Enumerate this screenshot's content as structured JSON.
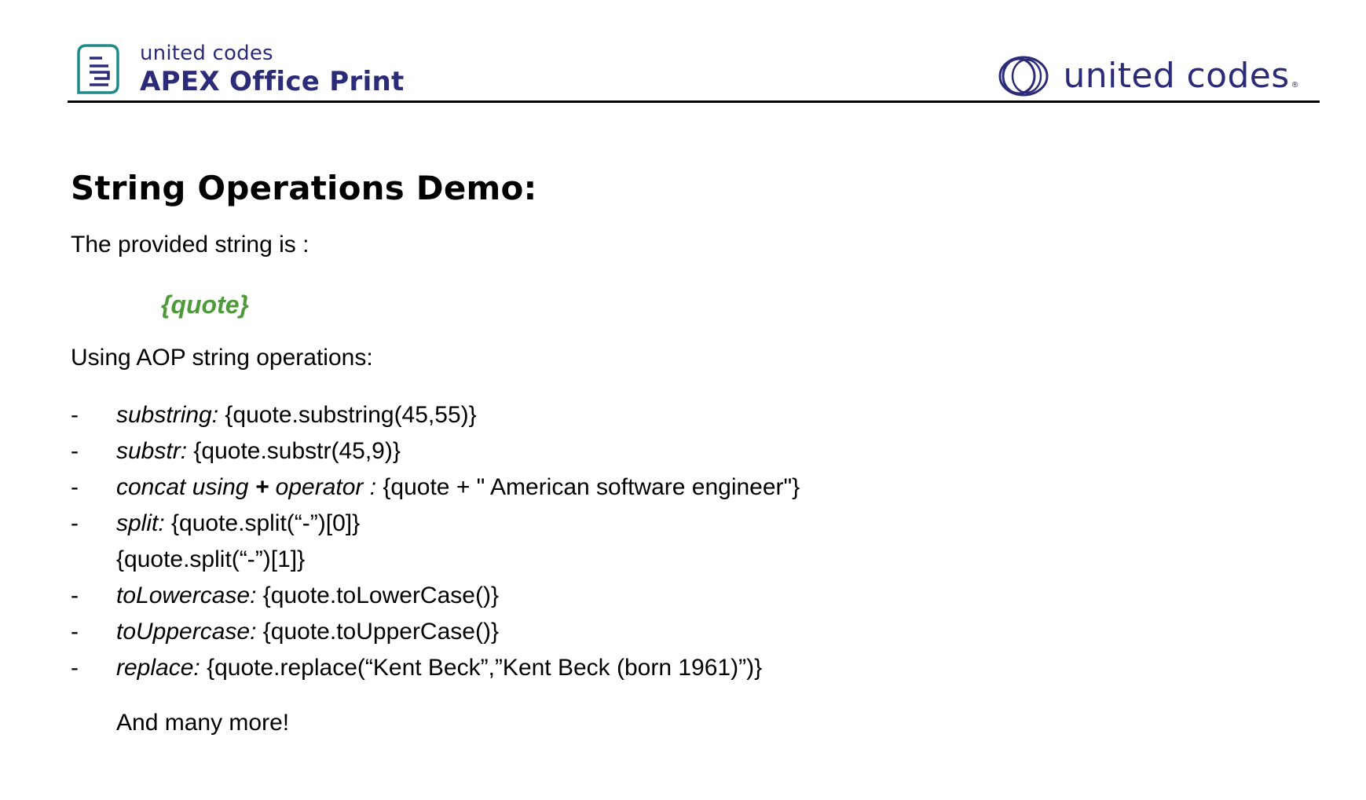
{
  "header": {
    "left_brand_sub": "united codes",
    "left_brand_main": "APEX Office Print",
    "right_brand": "united codes",
    "right_brand_mark": "®",
    "brand_color": "#2c2b78",
    "left_icon": "document-icon",
    "right_icon": "rings-logo-icon"
  },
  "document": {
    "title": "String Operations Demo:",
    "intro": "The provided string is :",
    "quote_placeholder": "{quote}",
    "quote_color": "#4e9a3a",
    "using": "Using AOP string operations:",
    "bullet": "-",
    "operations": [
      {
        "name": "substring:",
        "expr": " {quote.substring(45,55)}"
      },
      {
        "name": "substr:",
        "expr": " {quote.substr(45,9)}"
      },
      {
        "name_a": "concat using ",
        "name_plus": "+",
        "name_b": " operator :",
        "expr": " {quote +  \" American software engineer\"}"
      },
      {
        "name": "split:",
        "expr": " {quote.split(“-”)[0]}",
        "continuation": "{quote.split(“-”)[1]}"
      },
      {
        "name": "toLowercase:",
        "expr": " {quote.toLowerCase()}"
      },
      {
        "name": "toUppercase:",
        "expr": " {quote.toUpperCase()}"
      },
      {
        "name": "replace:",
        "expr": " {quote.replace(“Kent Beck”,”Kent Beck (born 1961)”)}"
      }
    ],
    "closing": "And many more!"
  }
}
